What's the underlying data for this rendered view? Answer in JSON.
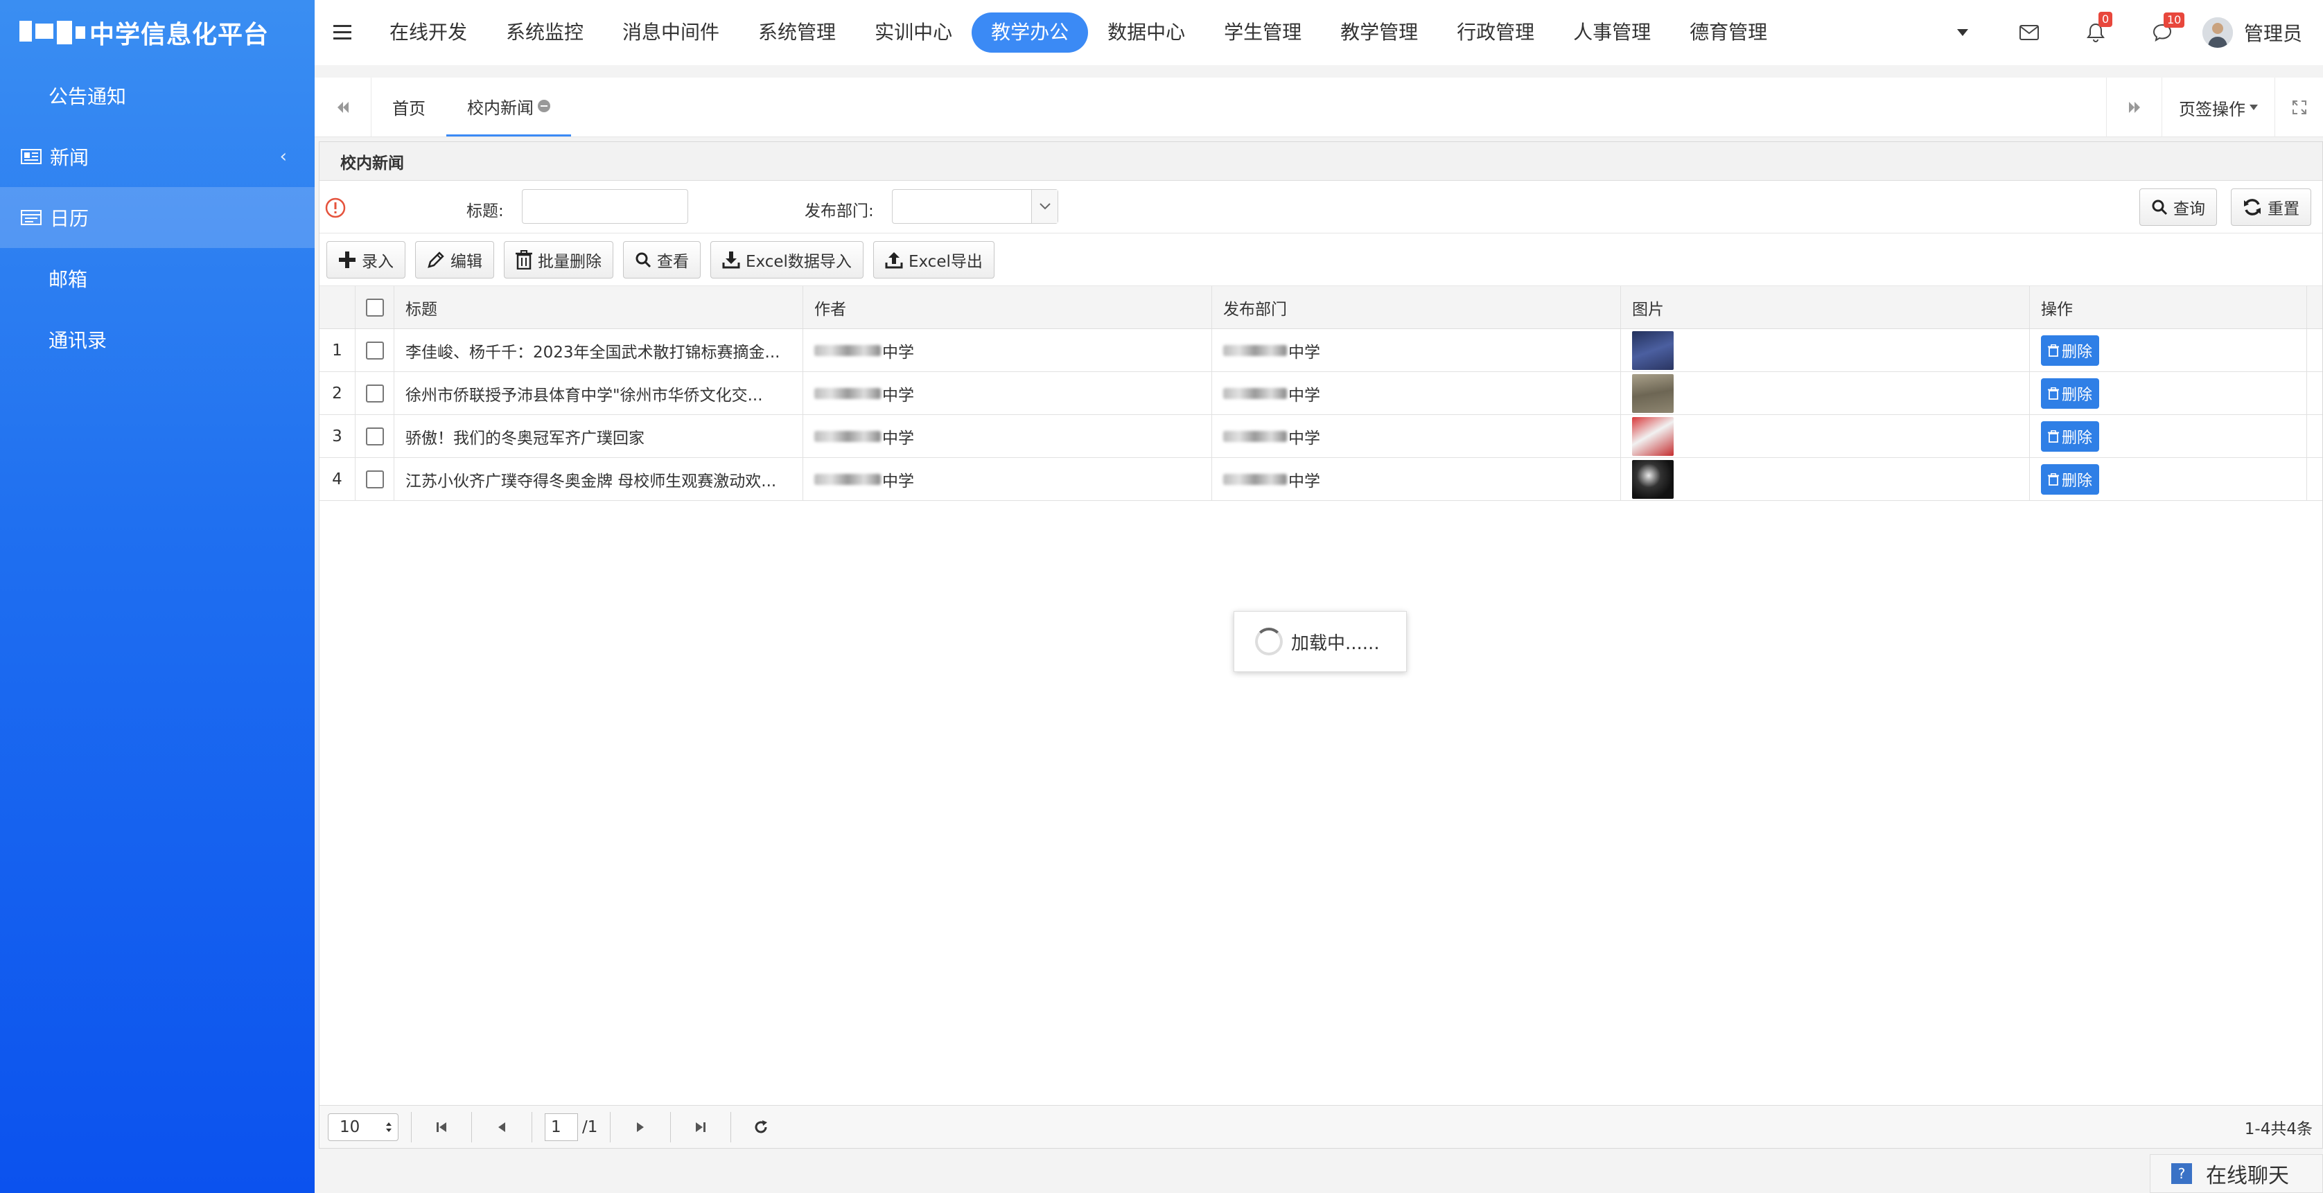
{
  "app": {
    "title": "中学信息化平台"
  },
  "sidebar": {
    "items": [
      {
        "label": "公告通知",
        "kind": "sub"
      },
      {
        "label": "新闻",
        "kind": "top"
      },
      {
        "label": "日历",
        "kind": "top",
        "active": true
      },
      {
        "label": "邮箱",
        "kind": "sub"
      },
      {
        "label": "通讯录",
        "kind": "sub"
      }
    ]
  },
  "topnav": {
    "tabs": [
      {
        "label": "在线开发"
      },
      {
        "label": "系统监控"
      },
      {
        "label": "消息中间件"
      },
      {
        "label": "系统管理"
      },
      {
        "label": "实训中心"
      },
      {
        "label": "教学办公",
        "active": true
      },
      {
        "label": "数据中心"
      },
      {
        "label": "学生管理"
      },
      {
        "label": "教学管理"
      },
      {
        "label": "行政管理"
      },
      {
        "label": "人事管理"
      },
      {
        "label": "德育管理"
      }
    ],
    "notify_count": "0",
    "message_count": "10",
    "user_name": "管理员"
  },
  "tabstrip": {
    "home": "首页",
    "current": "校内新闻",
    "ops": "页签操作"
  },
  "panel": {
    "title": "校内新闻",
    "search": {
      "title_label": "标题:",
      "title_value": "",
      "dept_label": "发布部门:",
      "dept_value": "",
      "query": "查询",
      "reset": "重置"
    },
    "toolbar": {
      "add": "录入",
      "edit": "编辑",
      "batch_delete": "批量删除",
      "view": "查看",
      "excel_import": "Excel数据导入",
      "excel_export": "Excel导出"
    },
    "table": {
      "columns": [
        "标题",
        "作者",
        "发布部门",
        "图片",
        "操作"
      ],
      "rows": [
        {
          "num": "1",
          "title": "李佳峻、杨千千：2023年全国武术散打锦标赛摘金...",
          "author": "中学",
          "dept": "中学",
          "action": "删除"
        },
        {
          "num": "2",
          "title": "徐州市侨联授予沛县体育中学\"徐州市华侨文化交...",
          "author": "中学",
          "dept": "中学",
          "action": "删除"
        },
        {
          "num": "3",
          "title": "骄傲！我们的冬奥冠军齐广璞回家",
          "author": "中学",
          "dept": "中学",
          "action": "删除"
        },
        {
          "num": "4",
          "title": "江苏小伙齐广璞夺得冬奥金牌 母校师生观赛激动欢...",
          "author": "中学",
          "dept": "中学",
          "action": "删除"
        }
      ]
    },
    "loading": "加载中......",
    "pager": {
      "page_size": "10",
      "page": "1",
      "total_pages": "/1",
      "info": "1-4共4条"
    }
  },
  "chat": {
    "label": "在线聊天"
  },
  "colors": {
    "accent": "#3b8af5",
    "sidebar_top": "#3a8ef2",
    "sidebar_bottom": "#0b52ee",
    "delete_btn": "#2f7fe6",
    "badge": "#e8473c"
  }
}
